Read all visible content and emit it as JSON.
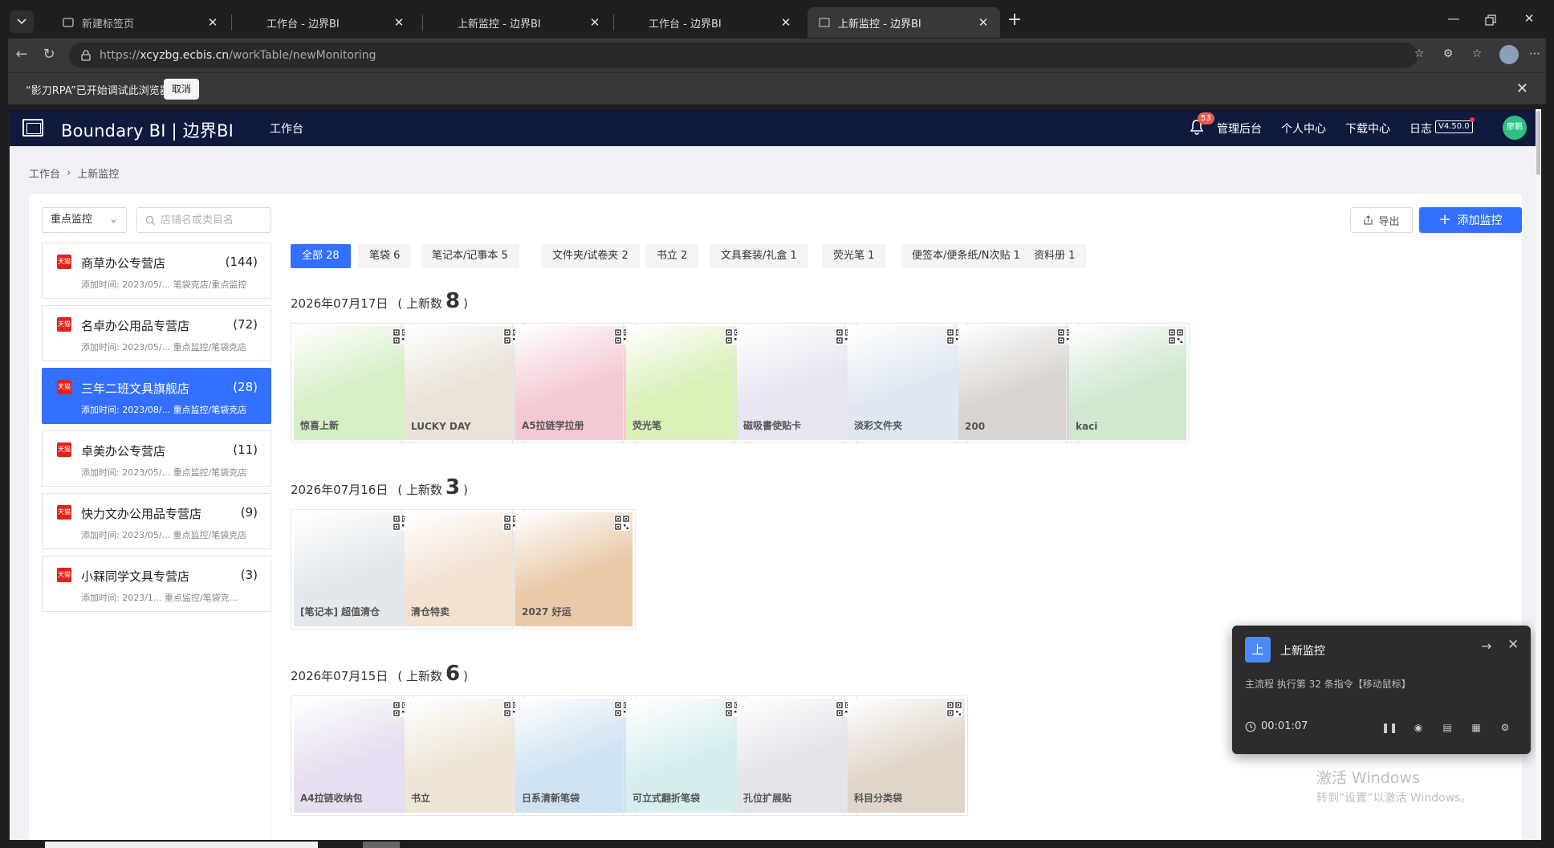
{
  "browser": {
    "tabs": [
      {
        "label": "新建标签页",
        "active": false
      },
      {
        "label": "工作台 - 边界BI",
        "active": false
      },
      {
        "label": "上新监控 - 边界BI",
        "active": false
      },
      {
        "label": "工作台 - 边界BI",
        "active": false
      },
      {
        "label": "上新监控 - 边界BI",
        "active": true
      }
    ],
    "url_prefix": "https://",
    "url_host": "xcyzbg.ecbis.cn",
    "url_path": "/workTable/newMonitoring",
    "infobar_message": "“影刀RPA”已开始调试此浏览器",
    "infobar_cancel": "取消"
  },
  "header": {
    "brand": "Boundary BI | 边界BI",
    "nav": "工作台",
    "notif_count": "53",
    "links": [
      "管理后台",
      "个人中心",
      "下载中心",
      "日志"
    ],
    "version": "V4.50.0",
    "avatar": "廖鹏"
  },
  "breadcrumb": {
    "home": "工作台",
    "current": "上新监控"
  },
  "toolbar": {
    "filter": "重点监控",
    "search_placeholder": "店铺名或类目名",
    "export": "导出",
    "add": "添加监控"
  },
  "shops": [
    {
      "name": "商草办公专营店",
      "count": "(144)",
      "sub": "添加时间: 2023/05/... 笔袋克店/重点监控",
      "active": false
    },
    {
      "name": "名卓办公用品专营店",
      "count": "(72)",
      "sub": "添加时间: 2023/05/... 重点监控/笔袋克店",
      "active": false
    },
    {
      "name": "三年二班文具旗舰店",
      "count": "(28)",
      "sub": "添加时间: 2023/08/... 重点监控/笔袋克店",
      "active": true
    },
    {
      "name": "卓美办公专营店",
      "count": "(11)",
      "sub": "添加时间: 2023/05/... 重点监控/笔袋克店",
      "active": false
    },
    {
      "name": "快力文办公用品专营店",
      "count": "(9)",
      "sub": "添加时间: 2023/05/... 重点监控/笔袋克店",
      "active": false
    },
    {
      "name": "小槑同学文具专营店",
      "count": "(3)",
      "sub": "添加时间: 2023/1... 重点监控/笔袋克...",
      "active": false
    }
  ],
  "categories": [
    {
      "label": "全部 28",
      "active": true
    },
    {
      "label": "笔袋 6",
      "active": false
    },
    {
      "label": "笔记本/记事本 5",
      "active": false
    },
    {
      "label": "文件夹/试卷夹 2",
      "active": false
    },
    {
      "label": "书立 2",
      "active": false
    },
    {
      "label": "文具套装/礼盒 1",
      "active": false
    },
    {
      "label": "荧光笔 1",
      "active": false
    },
    {
      "label": "便签本/便条纸/N次贴 1",
      "active": false
    },
    {
      "label": "资料册 1",
      "active": false
    }
  ],
  "days": [
    {
      "date": "2026年07月17日",
      "prefix": "( 上新数",
      "count": "8",
      "suffix": ")",
      "items": [
        {
          "caption": "惊喜上新",
          "color": "#d6efc6"
        },
        {
          "caption": "LUCKY DAY",
          "color": "#e9e2d6"
        },
        {
          "caption": "A5拉链学拉册",
          "color": "#f4c9d4"
        },
        {
          "caption": "荧光笔",
          "color": "#d9f0b8"
        },
        {
          "caption": "磁吸書使贴卡",
          "color": "#e7e6f1"
        },
        {
          "caption": "淡彩文件夹",
          "color": "#dfe8f2"
        },
        {
          "caption": "200",
          "color": "#d8d4d0"
        },
        {
          "caption": "kaci",
          "color": "#cfe7cf"
        }
      ]
    },
    {
      "date": "2026年07月16日",
      "prefix": "( 上新数",
      "count": "3",
      "suffix": ")",
      "items": [
        {
          "caption": "[笔记本] 超值清仓",
          "color": "#e3e8ec"
        },
        {
          "caption": "清仓特卖",
          "color": "#f3e1d2"
        },
        {
          "caption": "2027 好运",
          "color": "#e9c9a8"
        }
      ]
    },
    {
      "date": "2026年07月15日",
      "prefix": "( 上新数",
      "count": "6",
      "suffix": ")",
      "items": [
        {
          "caption": "A4拉链收纳包",
          "color": "#e6def0"
        },
        {
          "caption": "书立",
          "color": "#eee5d6"
        },
        {
          "caption": "日系清新笔袋",
          "color": "#cfe2f2"
        },
        {
          "caption": "可立式翻折笔袋",
          "color": "#d6eef0"
        },
        {
          "caption": "孔位扩展贴",
          "color": "#e3e3ea"
        },
        {
          "caption": "科目分类袋",
          "color": "#e0d5c8"
        }
      ]
    }
  ],
  "float_panel": {
    "icon": "上",
    "title": "上新监控",
    "status": "主流程 执行第 32 条指令【移动鼠标】",
    "time": "00:01:07"
  },
  "windows_watermark": {
    "line1": "激活 Windows",
    "line2": "转到“设置”以激活 Windows。"
  }
}
